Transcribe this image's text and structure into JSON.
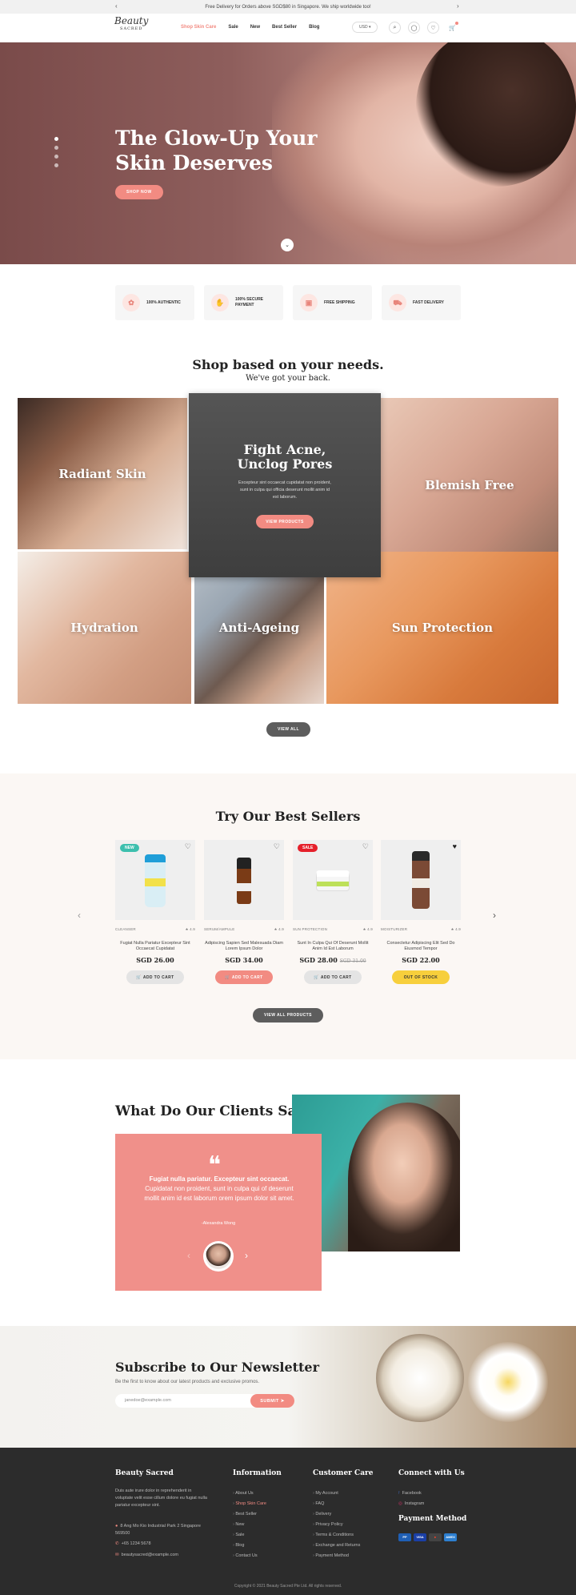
{
  "announcement": {
    "text": "Free Delivery for Orders above SGD$80 in Singapore. We ship worldwide too!",
    "prev": "‹",
    "next": "›"
  },
  "header": {
    "logo": "Beauty",
    "logo_sub": "SACRED",
    "nav": [
      "Shop Skin Care",
      "Sale",
      "New",
      "Best Seller",
      "Blog"
    ],
    "currency": "USD",
    "cart_count": ""
  },
  "hero": {
    "title_line1": "The Glow-Up Your",
    "title_line2": "Skin Deserves",
    "cta": "SHOP NOW"
  },
  "features": [
    "100% AUTHENTIC",
    "100% SECURE PAYMENT",
    "FREE SHIPPING",
    "FAST DELIVERY"
  ],
  "categories": {
    "title": "Shop based on your needs.",
    "subtitle": "We've got your back.",
    "featured": {
      "title_line1": "Fight Acne,",
      "title_line2": "Unclog Pores",
      "text": "Excepteur sint occaecat cupidatat non proident, sunt in culpa qui officia deserunt mollit anim id est laborum.",
      "cta": "VIEW PRODUCTS"
    },
    "tiles": [
      "Radiant Skin",
      "Blemish Free",
      "Hydration",
      "Anti-Ageing",
      "Sun Protection"
    ],
    "view_all": "VIEW ALL"
  },
  "best_sellers": {
    "title": "Try Our Best Sellers",
    "view_all": "VIEW ALL PRODUCTS",
    "products": [
      {
        "badge": "NEW",
        "category": "CLEANSER",
        "rating": "4.9",
        "name": "Fugiat Nulla Pariatur Excepteur Sint Occaecat Cupidatat",
        "price": "SGD 26.00",
        "old_price": "",
        "button": "ADD TO CART"
      },
      {
        "badge": "",
        "category": "SERUM/AMPULE",
        "rating": "4.9",
        "name": "Adipiscing Sapien Sed Malesuada Diam Lorem Ipsum Dolor",
        "price": "SGD 34.00",
        "old_price": "",
        "button": "ADD TO CART"
      },
      {
        "badge": "SALE",
        "category": "SUN PROTECTION",
        "rating": "4.9",
        "name": "Sunt In Culpa Qui Of Deserunt Mollit Anim Id Est Laborum",
        "price": "SGD 28.00",
        "old_price": "SGD 31.00",
        "button": "ADD TO CART"
      },
      {
        "badge": "",
        "category": "MOISTURIZER",
        "rating": "4.9",
        "name": "Consectetur Adipiscing Elit Sed Do Eiusmod Tempor",
        "price": "SGD 22.00",
        "old_price": "",
        "button": "OUT OF STOCK"
      }
    ]
  },
  "testimonials": {
    "title": "What Do Our Clients Say?",
    "quote_bold": "Fugiat nulla pariatur. Excepteur sint occaecat.",
    "quote": " Cupidatat non proident, sunt in culpa qui of deserunt mollit anim id est laborum orem ipsum dolor sit amet.",
    "author": "-Alexandra Wong"
  },
  "newsletter": {
    "title": "Subscribe to Our Newsletter",
    "text": "Be the first to know about our latest products and exclusive promos.",
    "placeholder": "janedoe@example.com",
    "button": "SUBMIT"
  },
  "footer": {
    "brand": "Beauty Sacred",
    "about": "Duis aute irure dolor in reprehenderit in voluptate velit esse cillum dolore eu fugiat nulla pariatur excepteur sint.",
    "address": "8 Ang Mo Kio Industrial Park 2 Singapore 569500",
    "phone": "+65 1234 5678",
    "email": "beautysacred@example.com",
    "info_title": "Information",
    "info_links": [
      "About Us",
      "Shop Skin Care",
      "Best Seller",
      "New",
      "Sale",
      "Blog",
      "Contact Us"
    ],
    "care_title": "Customer Care",
    "care_links": [
      "My Account",
      "FAQ",
      "Delivery",
      "Privacy Policy",
      "Terms & Conditions",
      "Exchange and Returns",
      "Payment Method"
    ],
    "connect_title": "Connect with Us",
    "social": [
      "Facebook",
      "Instagram"
    ],
    "payment_title": "Payment Method",
    "copyright": "Copyright © 2021 Beauty Sacred Pte Ltd. All rights reserved."
  }
}
